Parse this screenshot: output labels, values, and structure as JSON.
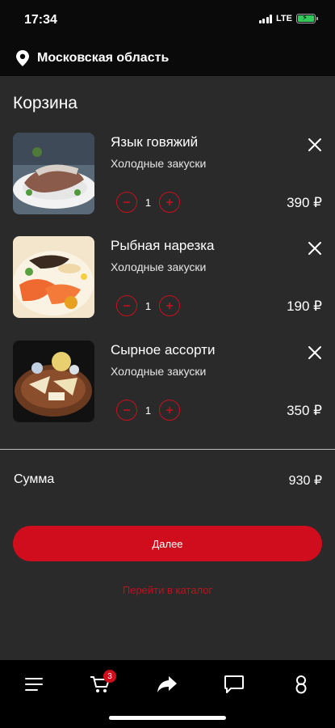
{
  "status_bar": {
    "time": "17:34",
    "network": "LTE"
  },
  "location": {
    "label": "Московская область",
    "icon": "location-pin-icon"
  },
  "page": {
    "title": "Корзина"
  },
  "cart": {
    "items": [
      {
        "name": "Язык говяжий",
        "category": "Холодные закуски",
        "quantity": "1",
        "price": "390 ₽",
        "image": "beef-tongue-dish"
      },
      {
        "name": "Рыбная нарезка",
        "category": "Холодные закуски",
        "quantity": "1",
        "price": "190 ₽",
        "image": "fish-platter"
      },
      {
        "name": "Сырное ассорти",
        "category": "Холодные закуски",
        "quantity": "1",
        "price": "350 ₽",
        "image": "cheese-board"
      }
    ]
  },
  "summary": {
    "label": "Сумма",
    "total": "930 ₽"
  },
  "actions": {
    "next_label": "Далее",
    "catalog_link": "Перейти в каталог"
  },
  "tab_bar": {
    "cart_badge": "3",
    "tabs": [
      "menu-icon",
      "cart-icon",
      "share-icon",
      "chat-icon",
      "profile-icon"
    ]
  },
  "colors": {
    "accent": "#d00d1c",
    "background": "#2a2a2a",
    "header": "#0a0a0a"
  }
}
